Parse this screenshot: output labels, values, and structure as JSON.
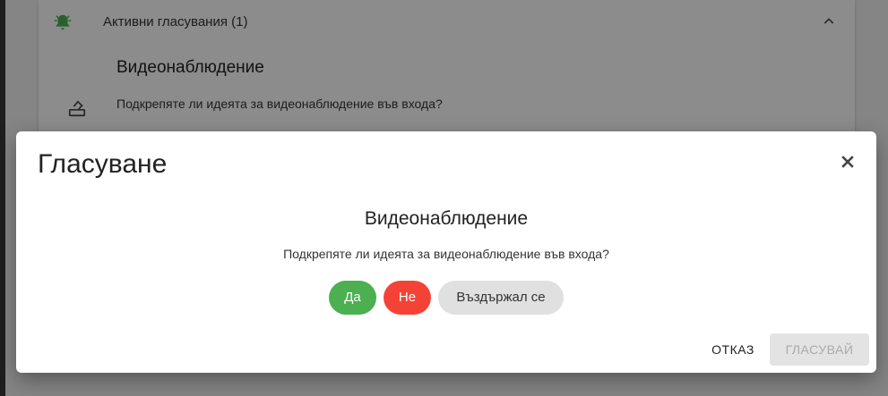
{
  "background_panel": {
    "title": "Активни гласувания (1)",
    "poll_title": "Видеонаблюдение",
    "poll_question": "Подкрепяте ли идеята за видеонаблюдение във входа?",
    "poll_extra": "",
    "icons": {
      "alarm": "alarm-bell-icon",
      "collapse": "chevron-up-icon",
      "vote": "ballot-box-icon"
    },
    "accent_color": "#4caf50"
  },
  "dialog": {
    "title": "Гласуване",
    "question_title": "Видеонаблюдение",
    "question_text": "Подкрепяте ли идеята за видеонаблюдение във входа?",
    "options": [
      {
        "label": "Да",
        "color": "#4caf50"
      },
      {
        "label": "Не",
        "color": "#f44336"
      },
      {
        "label": "Въздържал се",
        "color": "#e0e0e0"
      }
    ],
    "cancel_label": "ОТКАЗ",
    "vote_label": "ГЛАСУВАЙ",
    "vote_enabled": false,
    "close_icon": "close-icon"
  }
}
